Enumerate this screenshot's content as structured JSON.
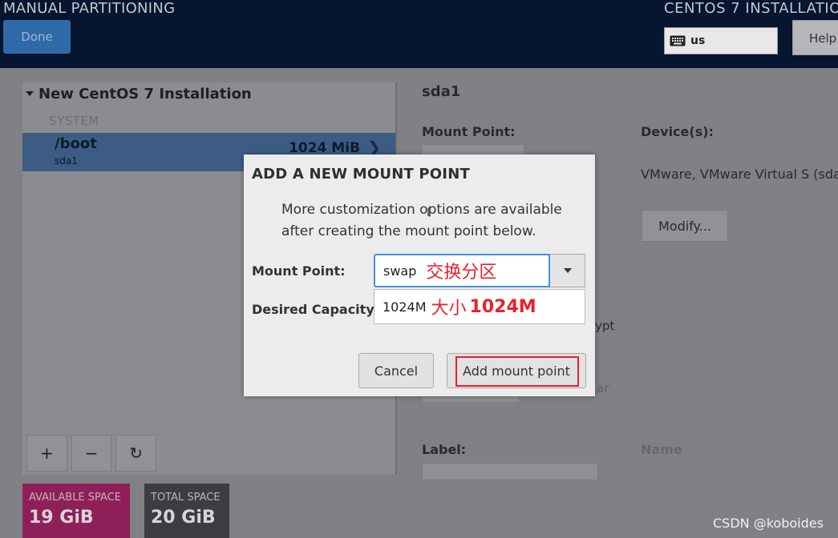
{
  "header": {
    "title": "MANUAL PARTITIONING",
    "right_title": "CENTOS 7 INSTALLATIO",
    "done_label": "Done",
    "keyboard_layout": "us",
    "help_label": "Help"
  },
  "left": {
    "tree_title": "New CentOS 7 Installation",
    "system_label": "SYSTEM",
    "partition": {
      "name": "/boot",
      "device": "sda1",
      "size": "1024 MiB"
    },
    "add_symbol": "+",
    "remove_symbol": "−",
    "refresh_symbol": "↻"
  },
  "space": {
    "available_label": "AVAILABLE SPACE",
    "available_value": "19 GiB",
    "total_label": "TOTAL SPACE",
    "total_value": "20 GiB"
  },
  "right": {
    "selected_title": "sda1",
    "mount_point_label": "Mount Point:",
    "devices_label": "Device(s):",
    "device_value": "VMware, VMware Virtual S (sda)",
    "modify_label": "Modify...",
    "encrypt_partial": "ypt",
    "ar_partial": "ar",
    "label_label": "Label:",
    "name_label": "Name"
  },
  "dialog": {
    "title": "ADD A NEW MOUNT POINT",
    "description": "More customization options are available after creating the mount point below.",
    "mount_point_label": "Mount Point:",
    "mount_point_value": "swap",
    "mount_point_annotation": "交换分区",
    "capacity_label": "Desired Capacity:",
    "capacity_value": "1024M",
    "capacity_annotation_cn": "大小",
    "capacity_annotation_num": "1024M",
    "cancel_label": "Cancel",
    "add_label": "Add mount point"
  },
  "watermark": "CSDN @koboides"
}
